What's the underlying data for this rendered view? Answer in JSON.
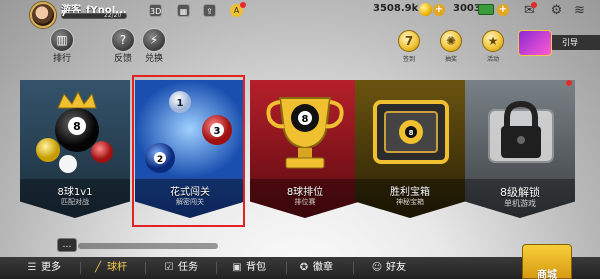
{
  "player": {
    "name": "游客_fYnoJ...",
    "level": "7",
    "xp": "22/20"
  },
  "top_icons": {
    "badge_3d": "3D",
    "badge_a": "A"
  },
  "currency": {
    "coins": "3508.9k",
    "cash": "3003"
  },
  "left_menu": [
    {
      "label": "排行",
      "icon": "ranking-icon"
    },
    {
      "label": "反馈",
      "icon": "feedback-icon"
    },
    {
      "label": "兑换",
      "icon": "exchange-icon"
    }
  ],
  "right_menu": [
    {
      "label": "签到",
      "icon": "checkin-icon",
      "glyph": "7"
    },
    {
      "label": "抽奖",
      "icon": "lottery-icon",
      "glyph": "✺"
    },
    {
      "label": "活动",
      "icon": "event-icon",
      "glyph": "★"
    }
  ],
  "promo": {
    "label": "引导"
  },
  "cards": [
    {
      "title": "8球1v1",
      "subtitle": "匹配对战",
      "icon": "8ball-crown-icon"
    },
    {
      "title": "花式闯关",
      "subtitle": "解密闯关",
      "icon": "balls-icon"
    },
    {
      "title": "8球排位",
      "subtitle": "排位赛",
      "icon": "trophy-icon"
    },
    {
      "title": "胜利宝箱",
      "subtitle": "神秘宝箱",
      "icon": "chest-icon"
    },
    {
      "title": "8级解锁",
      "subtitle": "单机游戏",
      "icon": "lock-icon"
    }
  ],
  "bottom_nav": [
    {
      "label": "更多",
      "icon": "menu-icon",
      "glyph": "☰"
    },
    {
      "label": "球杆",
      "icon": "cue-icon",
      "glyph": "╱"
    },
    {
      "label": "任务",
      "icon": "task-icon",
      "glyph": "☑"
    },
    {
      "label": "背包",
      "icon": "bag-icon",
      "glyph": "▣"
    },
    {
      "label": "徽章",
      "icon": "badge-icon",
      "glyph": "✪"
    },
    {
      "label": "好友",
      "icon": "friends-icon",
      "glyph": "☺"
    }
  ],
  "shop": {
    "label": "商城"
  },
  "colors": {
    "highlight": "#e52222",
    "gold": "#f0c030",
    "accent_nav": "#f5c84a"
  }
}
